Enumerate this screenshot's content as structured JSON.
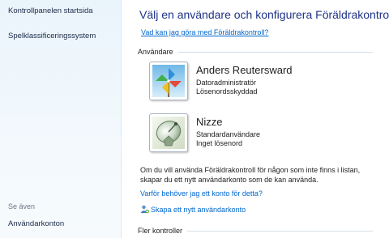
{
  "sidebar": {
    "links": [
      "Kontrollpanelen startsida",
      "Spelklassificeringssystem"
    ],
    "see_also_label": "Se även",
    "footer_link": "Användarkonton"
  },
  "main": {
    "title": "Välj en användare och konfigurera Föräldrakontroll",
    "help_link": "Vad kan jag göra med Föräldrakontroll?",
    "users_section": "Användare",
    "users": [
      {
        "name": "Anders Reutersward",
        "line1": "Datoradministratör",
        "line2": "Lösenordsskyddad",
        "avatar_icon": "pinwheel-icon"
      },
      {
        "name": "Nizze",
        "line1": "Standardanvändare",
        "line2": "Inget lösenord",
        "avatar_icon": "satellite-dish-icon"
      }
    ],
    "info_text": "Om du vill använda Föräldrakontroll för någon som inte finns i listan, skapar du ett nytt användarkonto som de kan använda.",
    "why_link": "Varför behöver jag ett konto för detta?",
    "create_link": "Skapa ett nytt användarkonto",
    "more_section": "Fler kontroller"
  }
}
